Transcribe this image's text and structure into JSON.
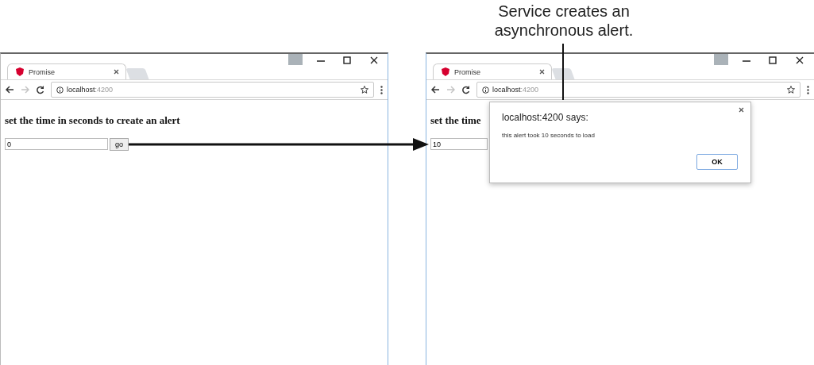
{
  "callout": "Service creates an asynchronous alert.",
  "windows": [
    {
      "tab": {
        "title": "Promise"
      },
      "address": {
        "host": "localhost",
        "port": ":4200"
      },
      "heading": "set the time in seconds to create an alert",
      "input": {
        "value": "0"
      },
      "button": "go"
    },
    {
      "tab": {
        "title": "Promise"
      },
      "address": {
        "host": "localhost",
        "port": ":4200"
      },
      "heading": "set the time",
      "input": {
        "value": "10"
      },
      "dialog": {
        "title": "localhost:4200 says:",
        "message": "this alert took 10 seconds to load",
        "button": "OK"
      }
    }
  ]
}
